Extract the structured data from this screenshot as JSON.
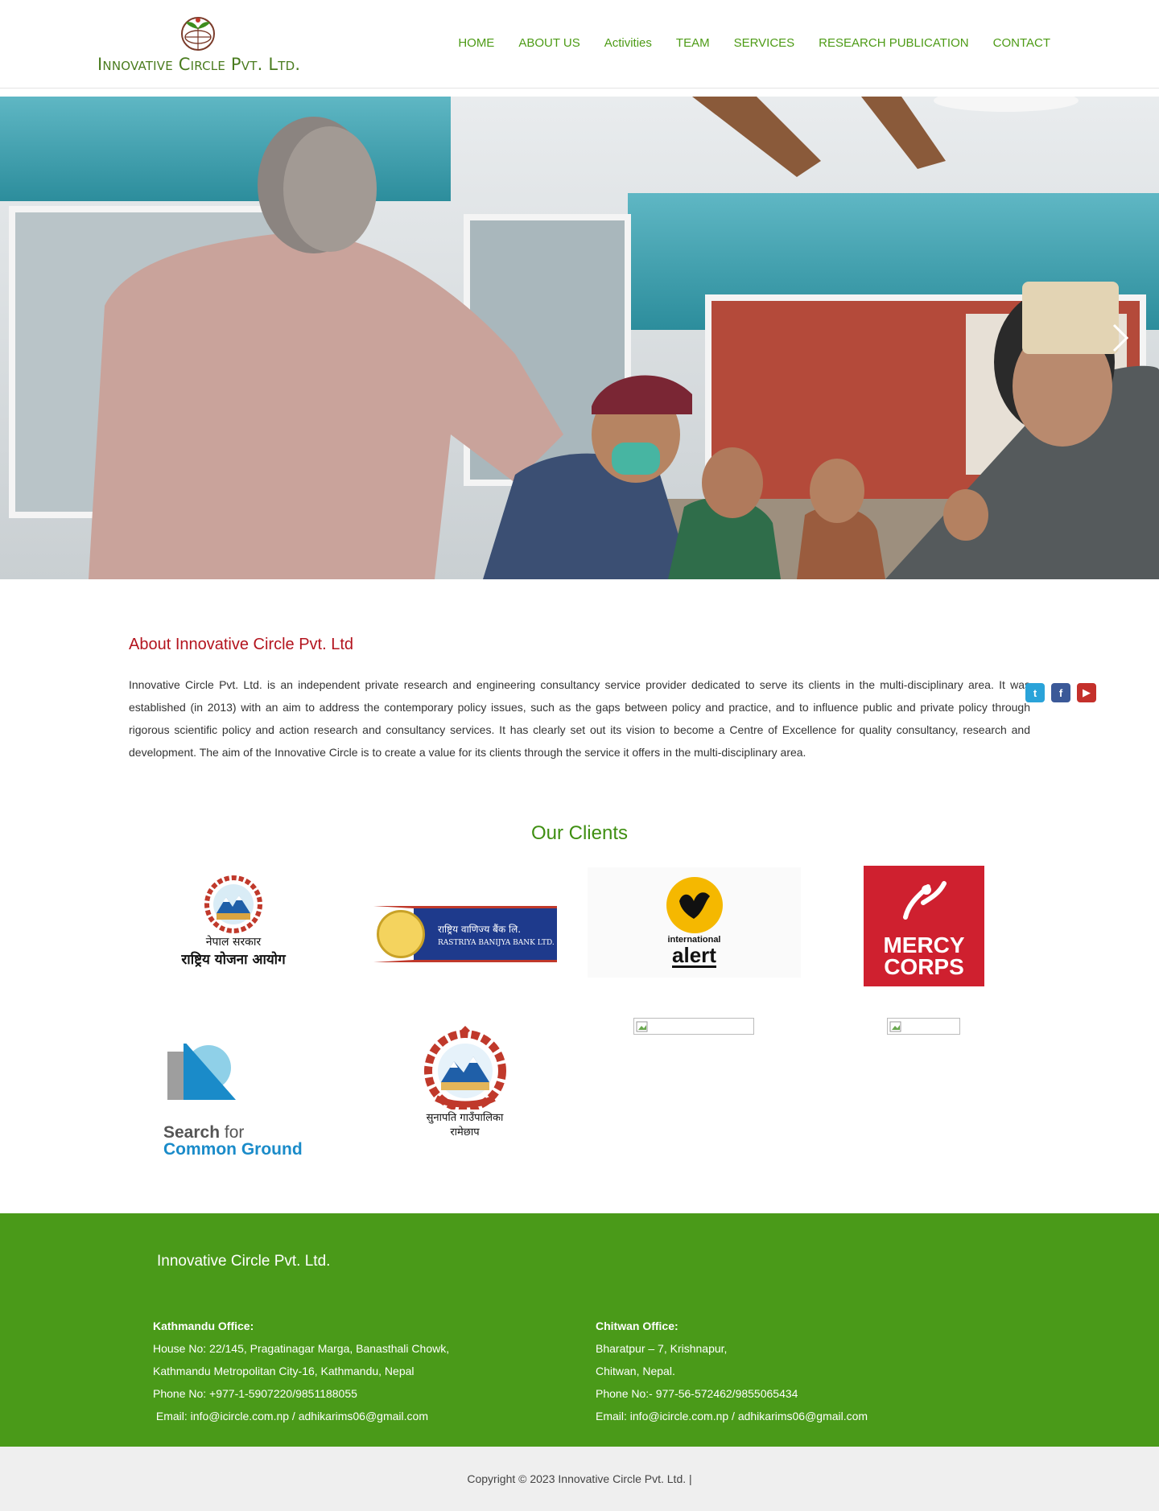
{
  "brand": {
    "name": "Innovative Circle Pvt. Ltd.",
    "accent": "#4d9b16",
    "heading_red": "#b3141e"
  },
  "nav": {
    "items": [
      "HOME",
      "ABOUT US",
      "Activities",
      "TEAM",
      "SERVICES",
      "RESEARCH PUBLICATION",
      "CONTACT"
    ]
  },
  "hero": {
    "next_icon": "chevron-right-icon"
  },
  "about": {
    "title": "About Innovative Circle Pvt. Ltd",
    "text": "Innovative Circle Pvt. Ltd. is an independent private research and engineering consultancy service provider dedicated to serve its clients in the multi-disciplinary area. It was established (in 2013) with an aim to address the contemporary policy issues, such as the gaps between policy and practice, and to influence public and private policy through rigorous scientific policy and action research and consultancy services. It has clearly set out its vision to become a Centre of Excellence for quality consultancy, research and development. The aim of the Innovative Circle is to create a value for its clients through the service it offers in the multi-disciplinary area."
  },
  "social": [
    "twitter-icon",
    "facebook-icon",
    "youtube-icon"
  ],
  "clients": {
    "title": "Our Clients",
    "npc": {
      "line1": "नेपाल सरकार",
      "line2": "राष्ट्रिय योजना आयोग"
    },
    "rbb": {
      "line1": "राष्ट्रिय वाणिज्य बैंक लि.",
      "line2": "RASTRIYA BANIJYA BANK LTD."
    },
    "alert": {
      "line1": "international",
      "line2": "alert"
    },
    "mercy": {
      "line1": "MERCY",
      "line2": "CORPS"
    },
    "sfcg": {
      "line1a": "Search ",
      "line1b": "for",
      "line2": "Common Ground"
    },
    "sunapati": {
      "line1": "सुनापति गाउँपालिका",
      "line2": "रामेछाप"
    }
  },
  "footer": {
    "title": "Innovative Circle Pvt. Ltd.",
    "kathmandu": {
      "heading": "Kathmandu Office:",
      "line1": "House No: 22/145, Pragatinagar Marga, Banasthali Chowk,",
      "line2": "Kathmandu Metropolitan City-16, Kathmandu, Nepal",
      "phone": "Phone No: +977-1-5907220/9851188055",
      "email": " Email: info@icircle.com.np / adhikarims06@gmail.com"
    },
    "chitwan": {
      "heading": "Chitwan Office:",
      "line1": "Bharatpur – 7, Krishnapur,",
      "line2": "Chitwan, Nepal.",
      "phone": "Phone No:- 977-56-572462/9855065434",
      "email": "Email: info@icircle.com.np / adhikarims06@gmail.com"
    }
  },
  "copyright": "Copyright © 2023 Innovative Circle Pvt. Ltd. |"
}
